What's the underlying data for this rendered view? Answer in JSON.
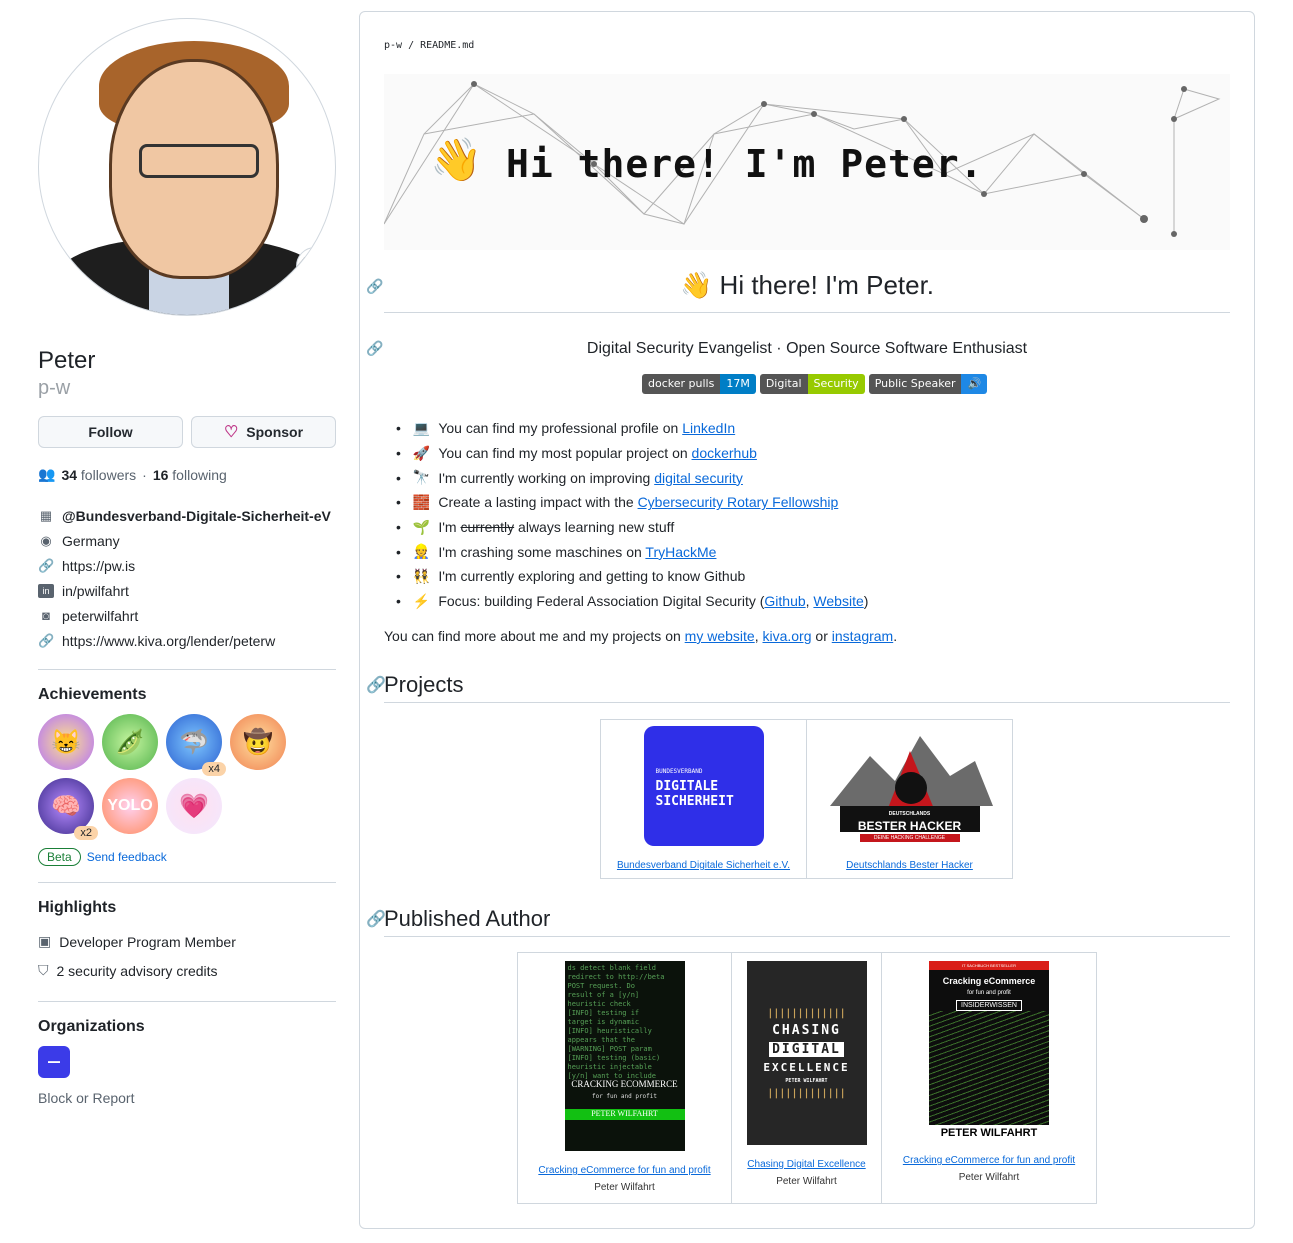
{
  "profile": {
    "name": "Peter",
    "login": "p-w",
    "follow_label": "Follow",
    "sponsor_label": "Sponsor",
    "followers_count": "34",
    "followers_label": "followers",
    "sep": "·",
    "following_count": "16",
    "following_label": "following",
    "details": [
      {
        "icon": "organization-icon",
        "text": "@Bundesverband-Digitale-Sicherheit-eV"
      },
      {
        "icon": "location-icon",
        "text": "Germany"
      },
      {
        "icon": "link-icon",
        "text": "https://pw.is"
      },
      {
        "icon": "linkedin-icon",
        "text": "in/pwilfahrt"
      },
      {
        "icon": "instagram-icon",
        "text": "peterwilfahrt"
      },
      {
        "icon": "link-icon",
        "text": "https://www.kiva.org/lender/peterw"
      }
    ],
    "achievements_title": "Achievements",
    "achievement_counts": [
      "x4",
      "x2"
    ],
    "beta_label": "Beta",
    "feedback_label": "Send feedback",
    "highlights_title": "Highlights",
    "highlights": [
      "Developer Program Member",
      "2 security advisory credits"
    ],
    "orgs_title": "Organizations",
    "block_label": "Block or Report"
  },
  "readme": {
    "crumb": "p-w / README.md",
    "banner_text": "Hi there! I'm Peter.",
    "heading": "Hi there! I'm Peter.",
    "wave": "👋",
    "subtitle": "Digital Security Evangelist · Open Source Software Enthusiast",
    "shields": [
      {
        "left": "docker pulls",
        "right": "17M",
        "color": "#007ec6"
      },
      {
        "left": "Digital",
        "right": "Security",
        "color": "#97ca00"
      },
      {
        "left": "Public Speaker",
        "right": "🔊",
        "color": "#1e88e5"
      }
    ],
    "bullets": [
      {
        "emoji": "💻",
        "pre": "You can find my professional profile on ",
        "link": "LinkedIn",
        "post": ""
      },
      {
        "emoji": "🚀",
        "pre": "You can find my most popular project on ",
        "link": "dockerhub",
        "post": ""
      },
      {
        "emoji": "🔭",
        "pre": "I'm currently working on improving ",
        "link": "digital security",
        "post": ""
      },
      {
        "emoji": "🧱",
        "pre": "Create a lasting impact with the ",
        "link": "Cybersecurity Rotary Fellowship",
        "post": ""
      },
      {
        "emoji": "🌱",
        "pre": "I'm ",
        "strike": "currently",
        "post": " always learning new stuff"
      },
      {
        "emoji": "👷",
        "pre": "I'm crashing some maschines on ",
        "link": "TryHackMe",
        "post": ""
      },
      {
        "emoji": "👯",
        "pre": "I'm currently exploring and getting to know Github",
        "post": ""
      },
      {
        "emoji": "⚡",
        "pre": "Focus: building Federal Association Digital Security (",
        "link": "Github",
        "mid": ", ",
        "link2": "Website",
        "post": ")"
      }
    ],
    "more_pre": "You can find more about me and my projects on ",
    "more_l1": "my website",
    "more_c1": ", ",
    "more_l2": "kiva.org",
    "more_c2": " or ",
    "more_l3": "instagram",
    "more_end": ".",
    "projects_title": "Projects",
    "projects": [
      {
        "name": "Bundesverband Digitale Sicherheit e.V.",
        "logo_top": "BUNDESVERBAND",
        "logo_l1": "DIGITALE",
        "logo_l2": "SICHERHEIT"
      },
      {
        "name": "Deutschlands Bester Hacker",
        "logo_top": "DEUTSCHLANDS",
        "logo_main": "BESTER HACKER",
        "logo_sub": "DEINE HACKING CHALLENGE"
      }
    ],
    "author_title": "Published Author",
    "books": [
      {
        "title": "Cracking eCommerce for fun and profit",
        "author": "Peter Wilfahrt",
        "cover_title": "CRACKING ECOMMERCE",
        "cover_sub": "for fun and profit",
        "cover_author": "PETER WILFAHRT"
      },
      {
        "title": "Chasing Digital Excellence",
        "author": "Peter Wilfahrt",
        "cover_l1": "CHASING",
        "cover_l2": "DIGITAL",
        "cover_l3": "EXCELLENCE",
        "cover_author": "PETER WILFAHRT"
      },
      {
        "title": "Cracking eCommerce for fun and profit",
        "author": "Peter Wilfahrt",
        "cover_top": "IT SACHBUCH BESTSELLER",
        "cover_title": "Cracking eCommerce",
        "cover_sub": "for fun and profit",
        "cover_badge": "INSIDERWISSEN",
        "cover_author": "PETER WILFAHRT"
      }
    ]
  }
}
